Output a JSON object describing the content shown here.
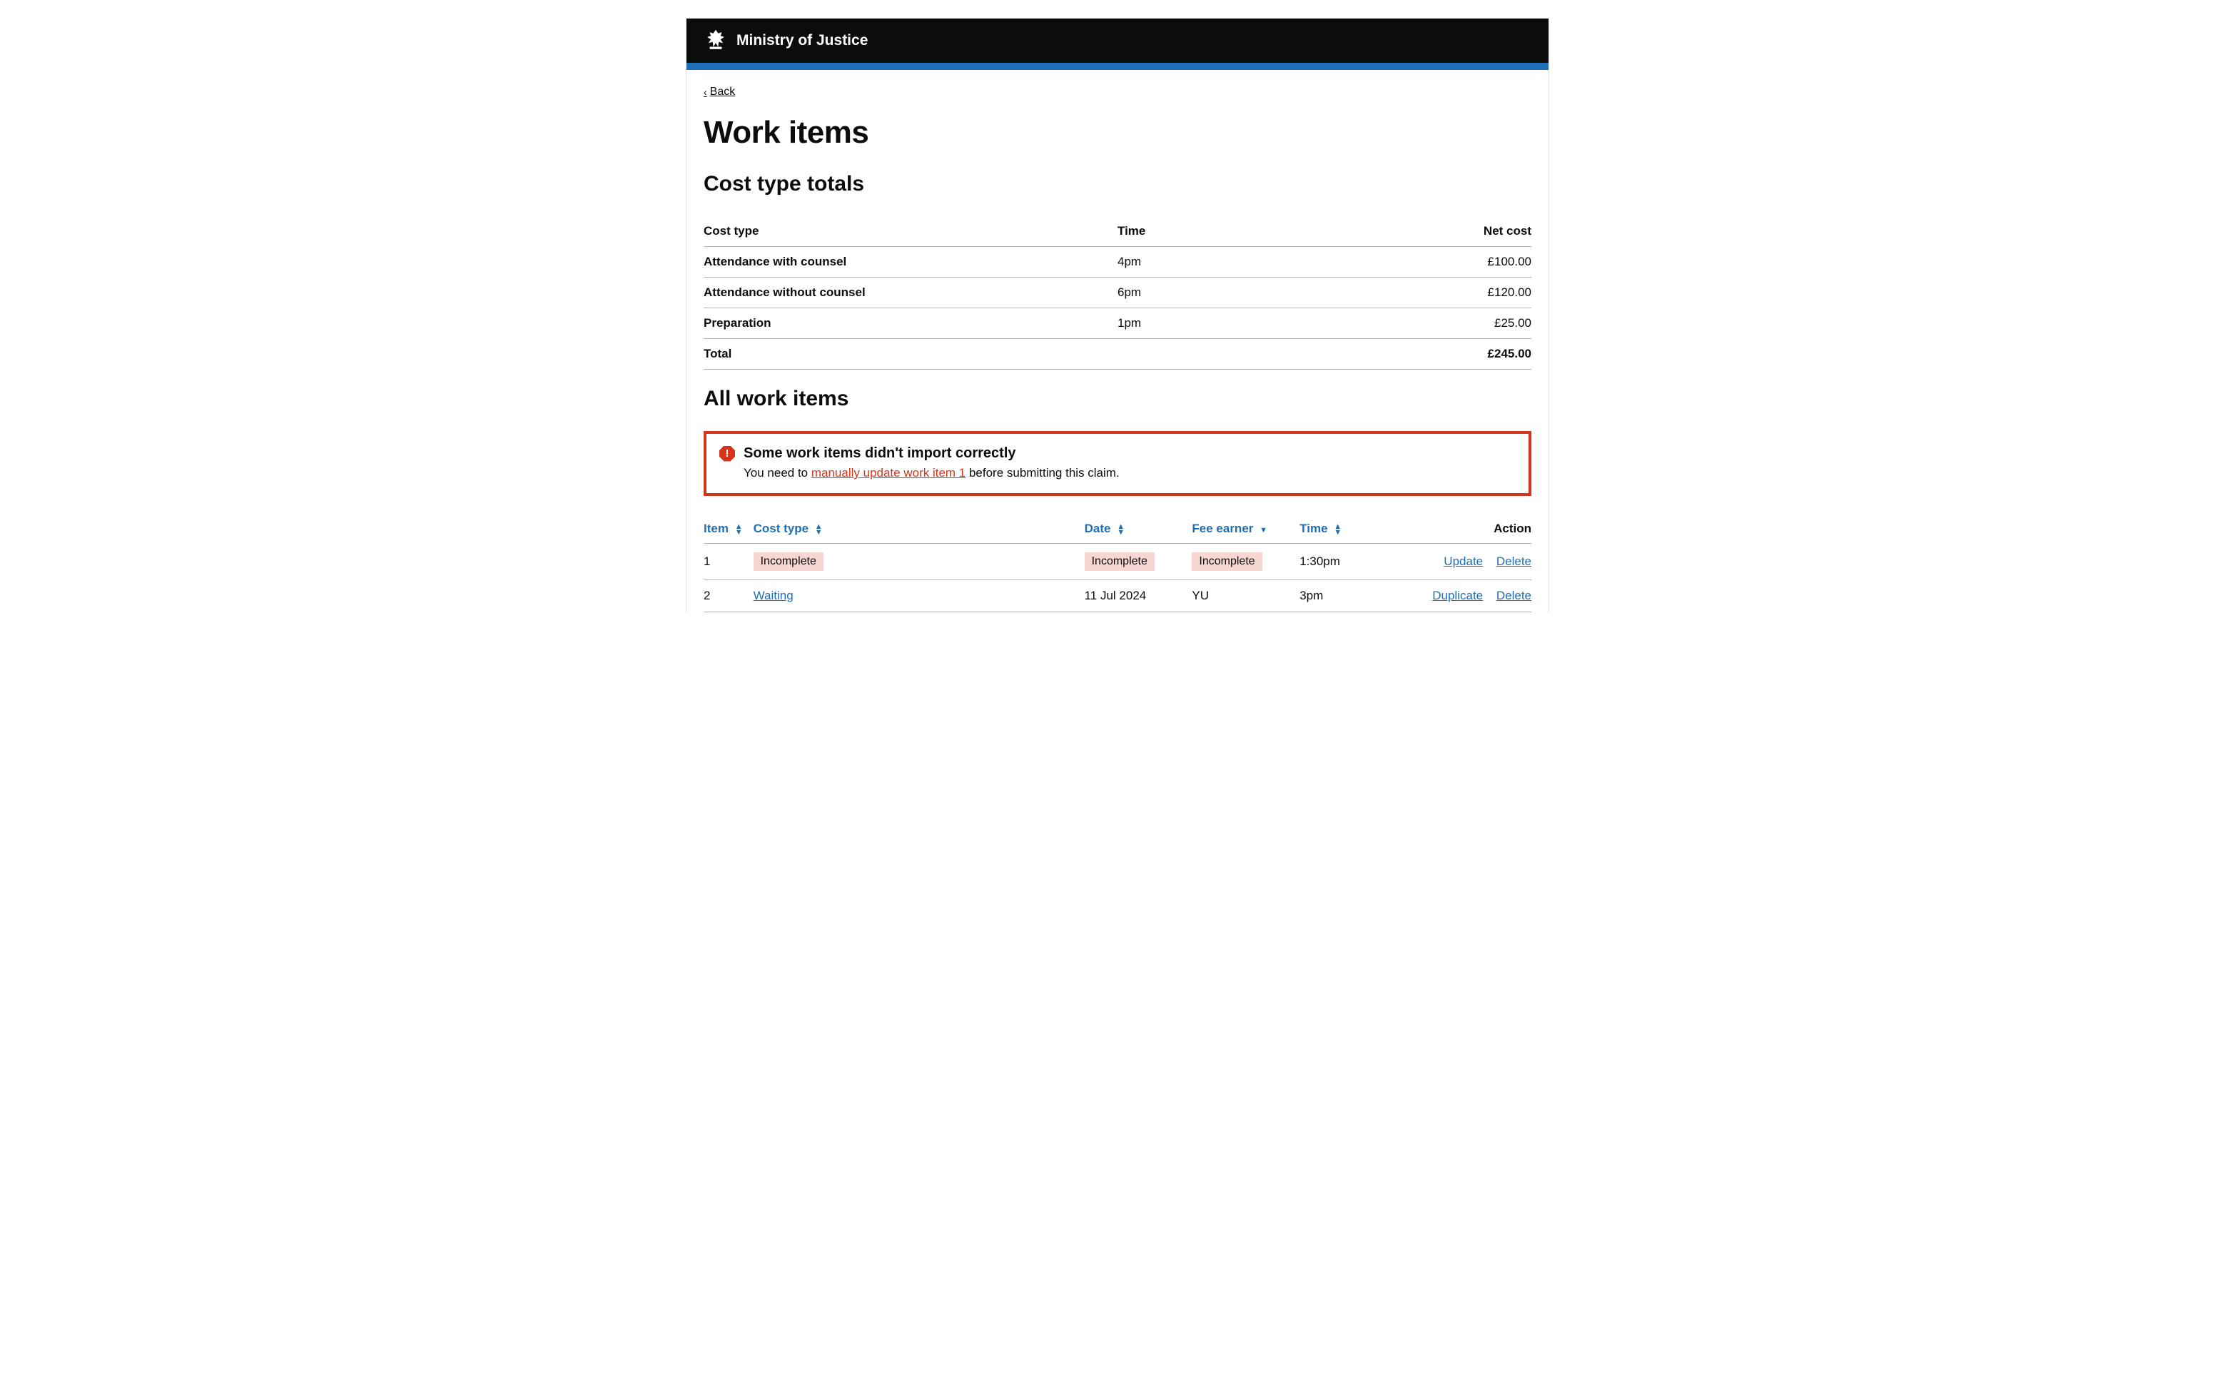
{
  "header": {
    "brand": "Ministry of Justice"
  },
  "nav": {
    "back_label": "Back"
  },
  "page": {
    "title": "Work items"
  },
  "totals_section": {
    "heading": "Cost type totals",
    "columns": {
      "type": "Cost type",
      "time": "Time",
      "net": "Net cost"
    },
    "rows": [
      {
        "type": "Attendance with counsel",
        "time": "4pm",
        "net": "£100.00"
      },
      {
        "type": "Attendance without counsel",
        "time": "6pm",
        "net": "£120.00"
      },
      {
        "type": "Preparation",
        "time": "1pm",
        "net": "£25.00"
      }
    ],
    "total_row": {
      "label": "Total",
      "net": "£245.00"
    }
  },
  "items_section": {
    "heading": "All work items",
    "alert": {
      "title": "Some work items didn't import correctly",
      "body_prefix": "You need to ",
      "body_link": "manually update work item 1",
      "body_suffix": " before submitting this claim."
    },
    "columns": {
      "item": "Item",
      "cost_type": "Cost type",
      "date": "Date",
      "fee_earner": "Fee earner",
      "time": "Time",
      "action": "Action"
    },
    "rows": [
      {
        "item": "1",
        "cost_type_tag": "Incomplete",
        "cost_type_is_tag": true,
        "date_tag": "Incomplete",
        "date_is_tag": true,
        "fee_tag": "Incomplete",
        "fee_is_tag": true,
        "time": "1:30pm",
        "action_primary": "Update",
        "action_secondary": "Delete"
      },
      {
        "item": "2",
        "cost_type_link": "Waiting",
        "cost_type_is_tag": false,
        "date": "11 Jul 2024",
        "date_is_tag": false,
        "fee": "YU",
        "fee_is_tag": false,
        "time": "3pm",
        "action_primary": "Duplicate",
        "action_secondary": "Delete"
      }
    ]
  }
}
